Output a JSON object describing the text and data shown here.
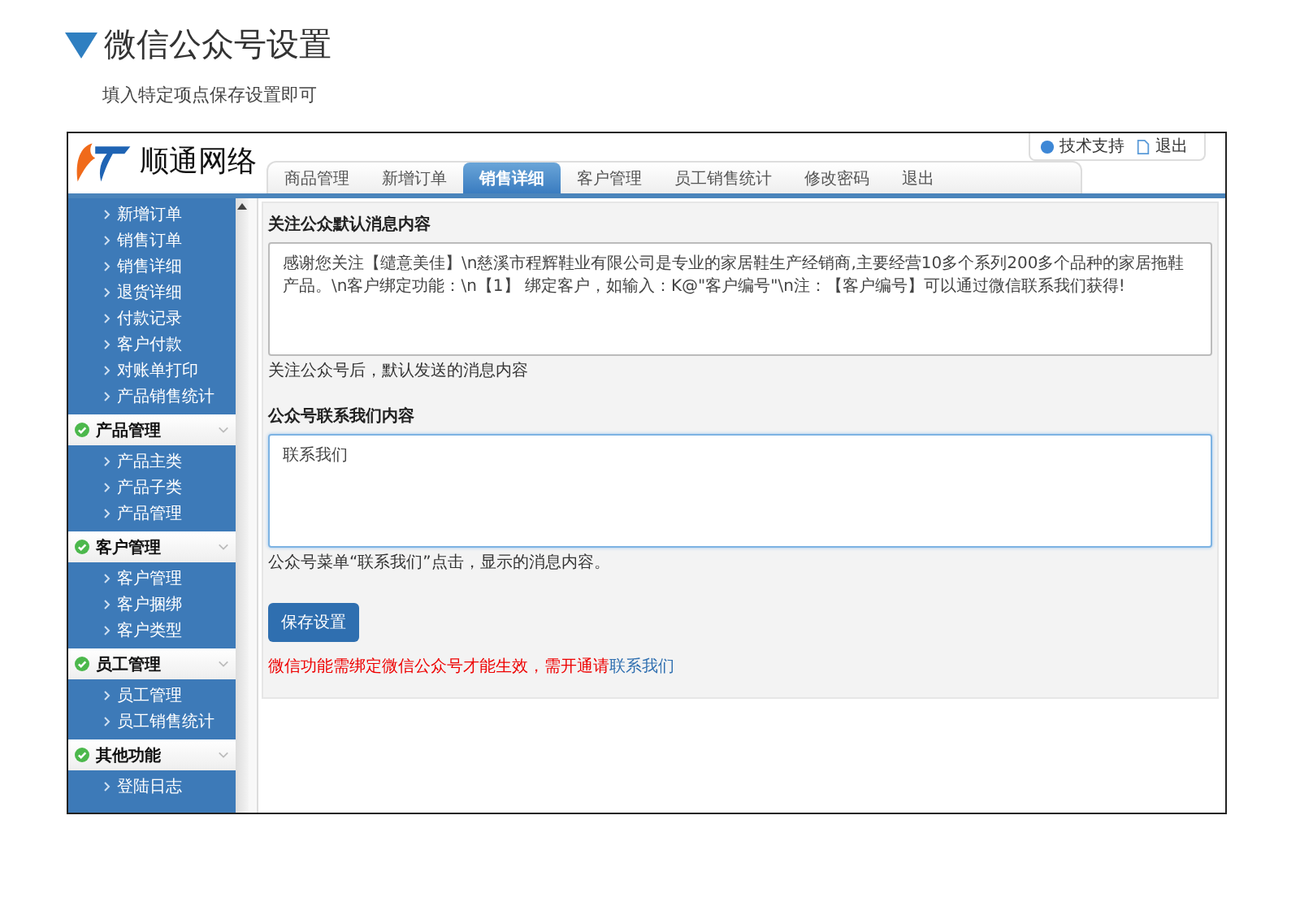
{
  "heading": {
    "title": "微信公众号设置",
    "subtitle": "填入特定项点保存设置即可"
  },
  "app": {
    "brand": "顺通网络",
    "top_links": [
      "技术支持",
      "退出"
    ],
    "tabs": [
      {
        "label": "商品管理",
        "selected": false
      },
      {
        "label": "新增订单",
        "selected": false
      },
      {
        "label": "销售详细",
        "selected": true
      },
      {
        "label": "客户管理",
        "selected": false
      },
      {
        "label": "员工销售统计",
        "selected": false
      },
      {
        "label": "修改密码",
        "selected": false
      },
      {
        "label": "退出",
        "selected": false
      }
    ],
    "sidebar": [
      {
        "items": [
          "新增订单",
          "销售订单",
          "销售详细",
          "退货详细",
          "付款记录",
          "客户付款",
          "对账单打印",
          "产品销售统计"
        ]
      },
      {
        "title": "产品管理",
        "items": [
          "产品主类",
          "产品子类",
          "产品管理"
        ]
      },
      {
        "title": "客户管理",
        "items": [
          "客户管理",
          "客户捆绑",
          "客户类型"
        ]
      },
      {
        "title": "员工管理",
        "items": [
          "员工管理",
          "员工销售统计"
        ]
      },
      {
        "title": "其他功能",
        "items": [
          "登陆日志"
        ]
      }
    ],
    "fields": [
      {
        "label": "关注公众默认消息内容",
        "value": "感谢您关注【缱意美佳】\\n慈溪市程辉鞋业有限公司是专业的家居鞋生产经销商,主要经营10多个系列200多个品种的家居拖鞋产品。\\n客户绑定功能：\\n【1】 绑定客户，如输入：K@\"客户编号\"\\n注：【客户编号】可以通过微信联系我们获得!",
        "hint": "关注公众号后，默认发送的消息内容",
        "focused": false
      },
      {
        "label": "公众号联系我们内容",
        "value": "联系我们",
        "hint": "公众号菜单“联系我们”点击，显示的消息内容。",
        "focused": true
      }
    ],
    "save_button": "保存设置",
    "notice": {
      "text": "微信功能需绑定微信公众号才能生效，需开通请",
      "link": "联系我们"
    }
  }
}
